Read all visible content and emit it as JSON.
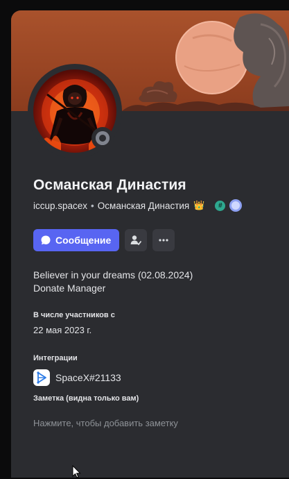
{
  "profile": {
    "display_name": "Османская Династия",
    "username": "iccup.spacex",
    "separator": "•",
    "server_tag": "Османская Династия",
    "crown_icon": "👑",
    "hash_badge": "#"
  },
  "actions": {
    "message_label": "Сообщение",
    "friend_icon": "person-check-icon",
    "more_icon": "more-dots-icon"
  },
  "about": {
    "line1": "Believer in your dreams (02.08.2024)",
    "line2": "Donate Manager"
  },
  "member_since": {
    "title": "В числе участников с",
    "value": "22 мая 2023 г."
  },
  "integrations": {
    "title": "Интеграции",
    "items": [
      {
        "name": "SpaceX#21133",
        "icon": "spacex-app-icon"
      }
    ]
  },
  "note": {
    "title": "Заметка (видна только вам)",
    "placeholder": "Нажмите, чтобы добавить заметку"
  },
  "colors": {
    "accent": "#5865f2",
    "banner": "#a9522c",
    "card": "#2b2c30"
  }
}
